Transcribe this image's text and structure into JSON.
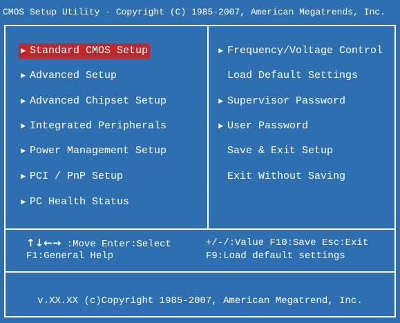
{
  "title": "CMOS Setup Utility - Copyright (C) 1985-2007, American Megatrends, Inc.",
  "colors": {
    "background": "#2e6fb1",
    "text": "#ffffff",
    "highlight": "#c0272d"
  },
  "left_menu": [
    {
      "label": "Standard CMOS Setup",
      "arrow": "►",
      "selected": true
    },
    {
      "label": "Advanced Setup",
      "arrow": "►"
    },
    {
      "label": "Advanced Chipset Setup",
      "arrow": "►"
    },
    {
      "label": "Integrated Peripherals",
      "arrow": "►"
    },
    {
      "label": "Power Management Setup",
      "arrow": "►"
    },
    {
      "label": "PCI / PnP Setup",
      "arrow": "►"
    },
    {
      "label": "PC Health Status",
      "arrow": "►"
    }
  ],
  "right_menu": [
    {
      "label": "Frequency/Voltage Control",
      "arrow": "►"
    },
    {
      "label": "Load Default Settings",
      "arrow": ""
    },
    {
      "label": "Supervisor Password",
      "arrow": "►"
    },
    {
      "label": "User Password",
      "arrow": "►"
    },
    {
      "label": "Save & Exit Setup",
      "arrow": ""
    },
    {
      "label": "Exit Without Saving",
      "arrow": ""
    }
  ],
  "help": {
    "arrows": "↑↓←→",
    "move": ":Move Enter:Select",
    "value": "+/-/:Value F10:Save Esc:Exit",
    "general": "F1:General Help",
    "defaults": "F9:Load default settings"
  },
  "footer": "v.XX.XX (c)Copyright 1985-2007, American Megatrend, Inc."
}
